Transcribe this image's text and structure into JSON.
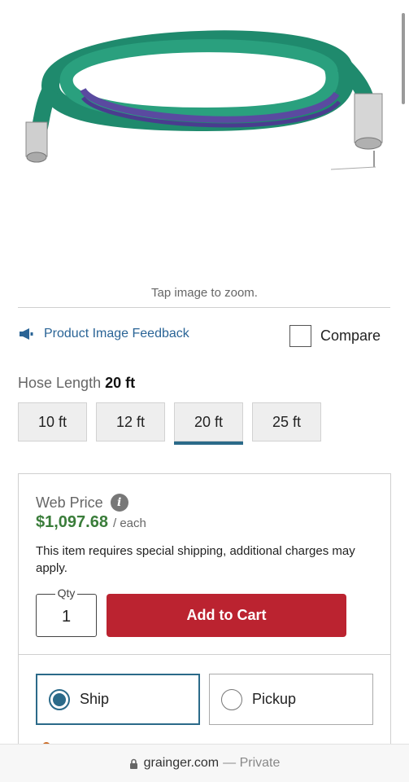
{
  "image": {
    "hint": "Tap image to zoom."
  },
  "feedback": {
    "label": "Product Image Feedback"
  },
  "compare": {
    "label": "Compare",
    "checked": false
  },
  "hose_length": {
    "label": "Hose Length",
    "selected": "20 ft",
    "options": [
      "10 ft",
      "12 ft",
      "20 ft",
      "25 ft"
    ]
  },
  "pricing": {
    "web_price_label": "Web Price",
    "price": "$1,097.68",
    "unit": "/ each",
    "shipping_note": "This item requires special shipping, additional charges may apply.",
    "qty_label": "Qty",
    "qty_value": "1",
    "add_to_cart": "Add to Cart"
  },
  "fulfillment": {
    "ship_label": "Ship",
    "pickup_label": "Pickup",
    "selected": "Ship"
  },
  "browser": {
    "domain": "grainger.com",
    "mode": "— Private"
  },
  "colors": {
    "link": "#2a6496",
    "price": "#3a7d3a",
    "cta": "#bb2330",
    "accent": "#2b6a89"
  }
}
